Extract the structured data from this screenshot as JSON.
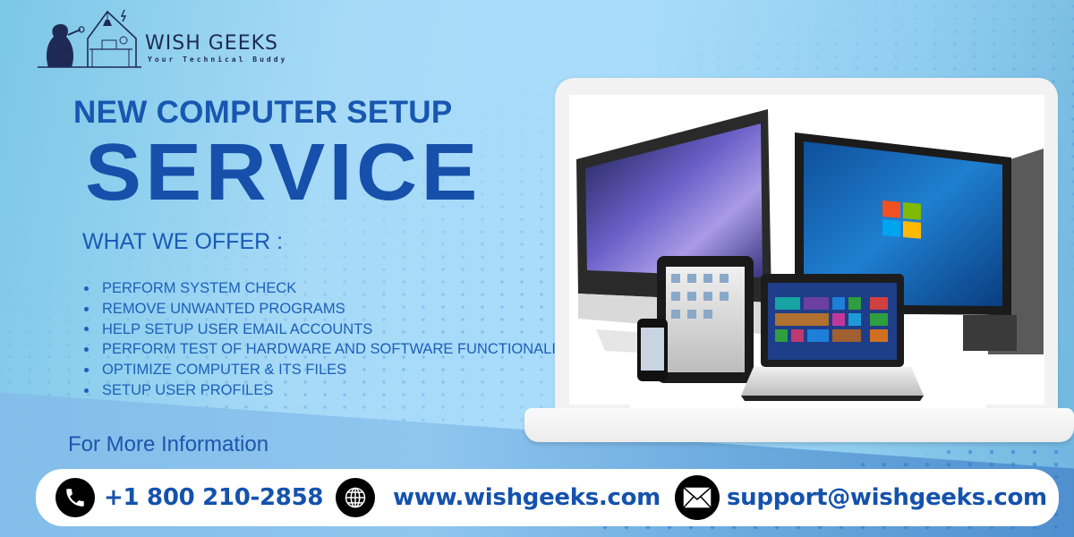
{
  "logo": {
    "name": "WISH GEEKS",
    "tagline": "Your Technical Buddy"
  },
  "headline": {
    "line1": "NEW COMPUTER SETUP",
    "line2": "SERVICE"
  },
  "offer": {
    "title": "WHAT WE OFFER :",
    "items": [
      "PERFORM SYSTEM CHECK",
      "REMOVE UNWANTED PROGRAMS",
      "HELP SETUP USER EMAIL ACCOUNTS",
      "PERFORM TEST OF HARDWARE AND SOFTWARE FUNCTIONALITY",
      "OPTIMIZE COMPUTER & ITS FILES",
      "SETUP USER PROFILES"
    ]
  },
  "more_info_label": "For More Information",
  "contact": {
    "phone": {
      "icon": "phone-icon",
      "value": "+1 800 210-2858"
    },
    "website": {
      "icon": "globe-icon",
      "value": "www.wishgeeks.com"
    },
    "email": {
      "icon": "envelope-icon",
      "value": "support@wishgeeks.com"
    }
  },
  "hero_image": {
    "description": "Laptop mockup showing iMac, Windows monitor with tower, iPad, iPhone and Windows 8 laptop"
  },
  "colors": {
    "brand_blue": "#1650aa",
    "logo_navy": "#1e2a55",
    "contact_text": "#1452ad"
  }
}
